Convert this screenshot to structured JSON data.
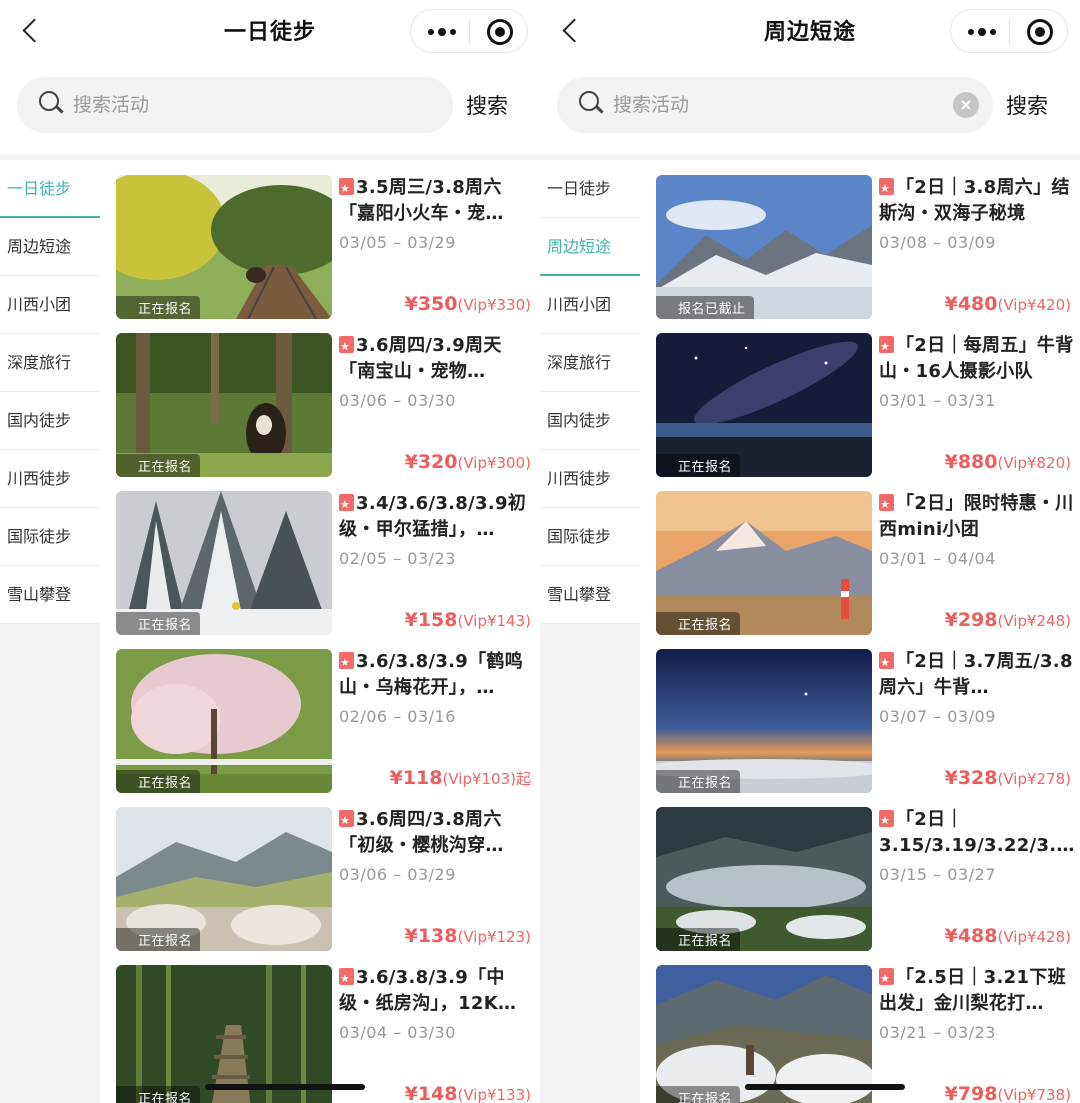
{
  "screens": [
    {
      "title": "一日徒步",
      "search": {
        "placeholder": "搜索活动",
        "button": "搜索"
      },
      "sidebar": [
        "一日徒步",
        "周边短途",
        "川西小团",
        "深度旅行",
        "国内徒步",
        "川西徒步",
        "国际徒步",
        "雪山攀登"
      ],
      "active_tab": 0,
      "cards": [
        {
          "title": "3.5周三/3.8周六「嘉阳小火车・宠…",
          "dates": "03/05 – 03/29",
          "price": "¥350",
          "vip": "(Vip¥330)",
          "status": "正在报名"
        },
        {
          "title": "3.6周四/3.9周天「南宝山・宠物…",
          "dates": "03/06 – 03/30",
          "price": "¥320",
          "vip": "(Vip¥300)",
          "status": "正在报名"
        },
        {
          "title": "3.4/3.6/3.8/3.9初级・甲尔猛措」，…",
          "dates": "02/05 – 03/23",
          "price": "¥158",
          "vip": "(Vip¥143)",
          "status": "正在报名"
        },
        {
          "title": "3.6/3.8/3.9「鹤鸣山・乌梅花开」，…",
          "dates": "02/06 – 03/16",
          "price": "¥118",
          "vip": "(Vip¥103)起",
          "status": "正在报名"
        },
        {
          "title": "3.6周四/3.8周六「初级・樱桃沟穿…",
          "dates": "03/06 – 03/29",
          "price": "¥138",
          "vip": "(Vip¥123)",
          "status": "正在报名"
        },
        {
          "title": "3.6/3.8/3.9「中级・纸房沟」，12K…",
          "dates": "03/04 – 03/30",
          "price": "¥148",
          "vip": "(Vip¥133)",
          "status": "正在报名"
        }
      ]
    },
    {
      "title": "周边短途",
      "search": {
        "placeholder": "搜索活动",
        "button": "搜索"
      },
      "sidebar": [
        "一日徒步",
        "周边短途",
        "川西小团",
        "深度旅行",
        "国内徒步",
        "川西徒步",
        "国际徒步",
        "雪山攀登"
      ],
      "active_tab": 1,
      "cards": [
        {
          "title": "「2日｜3.8周六」结斯沟・双海子秘境",
          "dates": "03/08 – 03/09",
          "price": "¥480",
          "vip": "(Vip¥420)",
          "status": "报名已截止"
        },
        {
          "title": "「2日｜每周五」牛背山・16人摄影小队",
          "dates": "03/01 – 03/31",
          "price": "¥880",
          "vip": "(Vip¥820)",
          "status": "正在报名"
        },
        {
          "title": "「2日」限时特惠・川西mini小团",
          "dates": "03/01 – 04/04",
          "price": "¥298",
          "vip": "(Vip¥248)",
          "status": "正在报名"
        },
        {
          "title": "「2日｜3.7周五/3.8周六」牛背…",
          "dates": "03/07 – 03/09",
          "price": "¥328",
          "vip": "(Vip¥278)",
          "status": "正在报名"
        },
        {
          "title": "「2日｜3.15/3.19/3.22/3.…",
          "dates": "03/15 – 03/27",
          "price": "¥488",
          "vip": "(Vip¥428)",
          "status": "正在报名"
        },
        {
          "title": "「2.5日｜3.21下班出发」金川梨花打…",
          "dates": "03/21 – 03/23",
          "price": "¥798",
          "vip": "(Vip¥738)",
          "status": "正在报名"
        }
      ]
    }
  ],
  "colors": {
    "accent": "#3fb5ad",
    "price": "#ee5d5d",
    "bookmark": "#f06a6a"
  },
  "icons": [
    "back-icon",
    "more-icon",
    "target-icon",
    "search-icon",
    "clear-icon",
    "bookmark-icon"
  ]
}
